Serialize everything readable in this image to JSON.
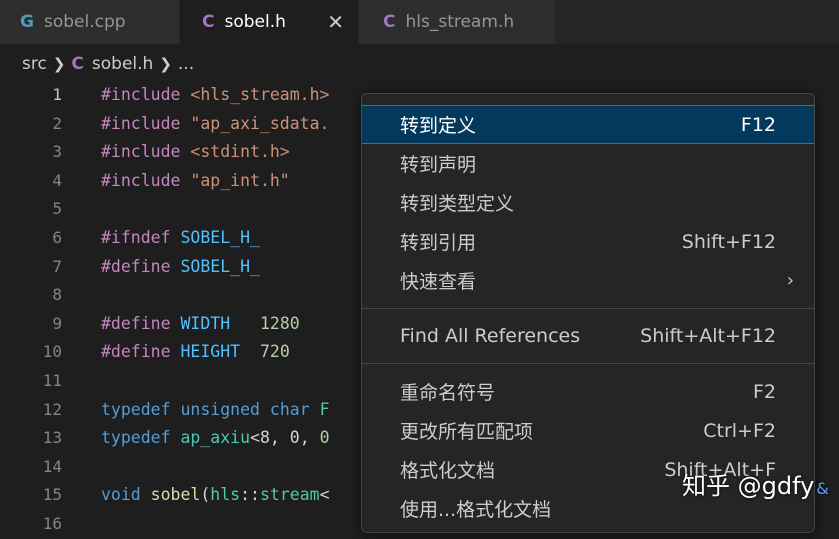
{
  "tabs": [
    {
      "icon": "G",
      "label": "sobel.cpp"
    },
    {
      "icon": "C",
      "label": "sobel.h",
      "close": "✕"
    },
    {
      "icon": "C",
      "label": "hls_stream.h"
    }
  ],
  "breadcrumb": {
    "folder": "src",
    "icon": "C",
    "file": "sobel.h",
    "more": "..."
  },
  "lines": [
    {
      "n": "1",
      "code": [
        "#include ",
        "<hls_stream.h>"
      ]
    },
    {
      "n": "2",
      "code": [
        "#include ",
        "\"ap_axi_sdata."
      ]
    },
    {
      "n": "3",
      "code": [
        "#include ",
        "<stdint.h>"
      ]
    },
    {
      "n": "4",
      "code": [
        "#include ",
        "\"ap_int.h\""
      ]
    },
    {
      "n": "5"
    },
    {
      "n": "6",
      "code": [
        "#ifndef ",
        "SOBEL_H_"
      ]
    },
    {
      "n": "7",
      "code": [
        "#define ",
        "SOBEL_H_"
      ]
    },
    {
      "n": "8"
    },
    {
      "n": "9",
      "code": [
        "#define ",
        "WIDTH",
        "   ",
        "1280"
      ]
    },
    {
      "n": "10",
      "code": [
        "#define ",
        "HEIGHT",
        "  ",
        "720"
      ]
    },
    {
      "n": "11"
    },
    {
      "n": "12",
      "code": [
        "typedef ",
        "unsigned ",
        "char ",
        "F"
      ]
    },
    {
      "n": "13",
      "code": [
        "typedef ",
        "ap_axiu",
        "<8, 0, ",
        "0"
      ]
    },
    {
      "n": "14"
    },
    {
      "n": "15",
      "code": [
        "void ",
        "sobel",
        "(",
        "hls",
        "::",
        "stream",
        "<"
      ]
    },
    {
      "n": "16"
    }
  ],
  "menu": {
    "groups": [
      [
        {
          "label": "转到定义",
          "key": "F12",
          "selected": true
        },
        {
          "label": "转到声明",
          "key": ""
        },
        {
          "label": "转到类型定义",
          "key": ""
        },
        {
          "label": "转到引用",
          "key": "Shift+F12"
        },
        {
          "label": "快速查看",
          "key": "",
          "submenu": "›"
        }
      ],
      [
        {
          "label": "Find All References",
          "key": "Shift+Alt+F12"
        }
      ],
      [
        {
          "label": "重命名符号",
          "key": "F2"
        },
        {
          "label": "更改所有匹配项",
          "key": "Ctrl+F2"
        },
        {
          "label": "格式化文档",
          "key": "Shift+Alt+F"
        },
        {
          "label": "使用...格式化文档",
          "key": ""
        }
      ]
    ]
  },
  "watermark": {
    "text": "知乎 @gdfy",
    "suffix": "&"
  },
  "colors": {
    "accent": "#007fd4",
    "selection": "#04395e",
    "keyword": "#c586c0",
    "string": "#ce9178",
    "macro": "#4fc1ff",
    "number": "#b5cea8"
  }
}
